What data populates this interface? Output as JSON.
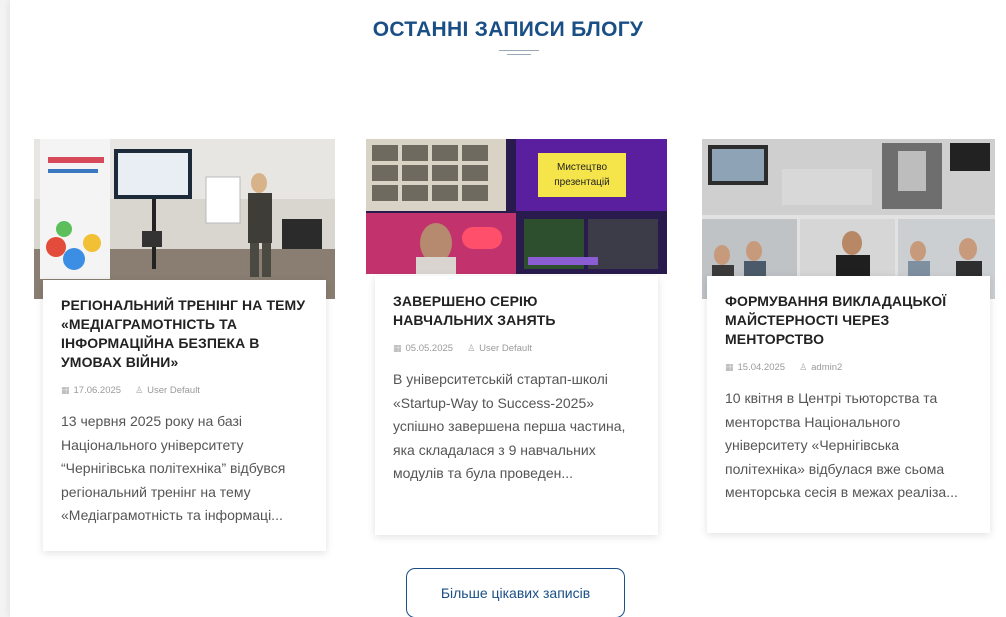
{
  "section": {
    "title": "ОСТАННІ ЗАПИСИ БЛОГУ"
  },
  "posts": [
    {
      "title": "РЕГІОНАЛЬНИЙ ТРЕНІНГ НА ТЕМУ «МЕДІАГРАМОТНІСТЬ ТА ІНФОРМАЦІЙНА БЕЗПЕКА В УМОВАХ ВІЙНИ»",
      "date": "17.06.2025",
      "author": "User Default",
      "excerpt": "13 червня 2025 року на базі Національного університету “Чернігівська політехніка” відбувся регіональний тренінг на тему «Медіаграмотність та інформаці...",
      "image_icon": "training-photo"
    },
    {
      "title": "ЗАВЕРШЕНО СЕРІЮ НАВЧАЛЬНИХ ЗАНЯТЬ",
      "date": "05.05.2025",
      "author": "User Default",
      "excerpt": "В університетській стартап-школі «Startup-Way to Success-2025» успішно завершена перша частина, яка складалася з 9 навчальних модулів та була проведен...",
      "image_icon": "online-presentation-collage",
      "image_text": "Мистецтво презентацій"
    },
    {
      "title": "ФОРМУВАННЯ ВИКЛАДАЦЬКОЇ МАЙСТЕРНОСТІ ЧЕРЕЗ МЕНТОРСТВО",
      "date": "15.04.2025",
      "author": "admin2",
      "excerpt": "10 квітня в Центрі тьюторства та менторства Національного університету «Чернігівська політехніка» відбулася вже сьома менторська сесія в межах реаліза...",
      "image_icon": "mentoring-session-collage"
    }
  ],
  "more_button": {
    "label": "Більше цікавих записів"
  },
  "colors": {
    "accent": "#1a4f86",
    "title_text": "#222222",
    "meta_text": "#9a9a9a"
  }
}
